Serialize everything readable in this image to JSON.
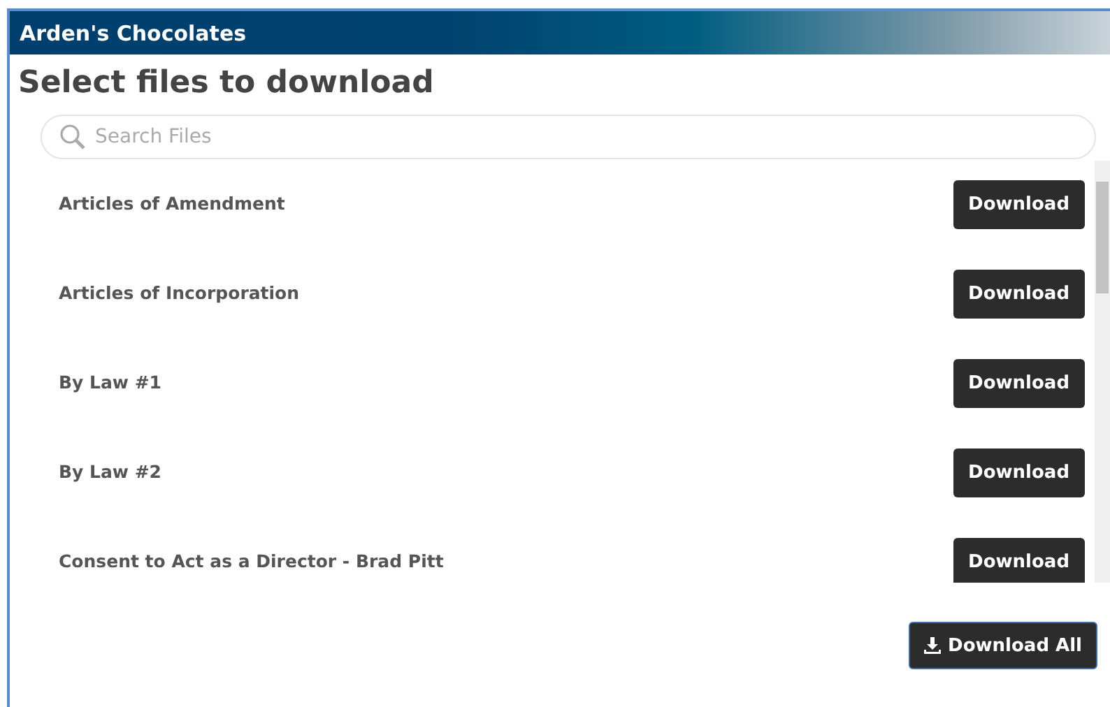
{
  "window": {
    "title": "Arden's Chocolates"
  },
  "heading": "Select files to download",
  "search": {
    "placeholder": "Search Files"
  },
  "files": [
    {
      "name": "Articles of Amendment",
      "action": "Download"
    },
    {
      "name": "Articles of Incorporation",
      "action": "Download"
    },
    {
      "name": "By Law #1",
      "action": "Download"
    },
    {
      "name": "By Law #2",
      "action": "Download"
    },
    {
      "name": "Consent to Act as a Director - Brad Pitt",
      "action": "Download"
    }
  ],
  "download_all": "Download All"
}
